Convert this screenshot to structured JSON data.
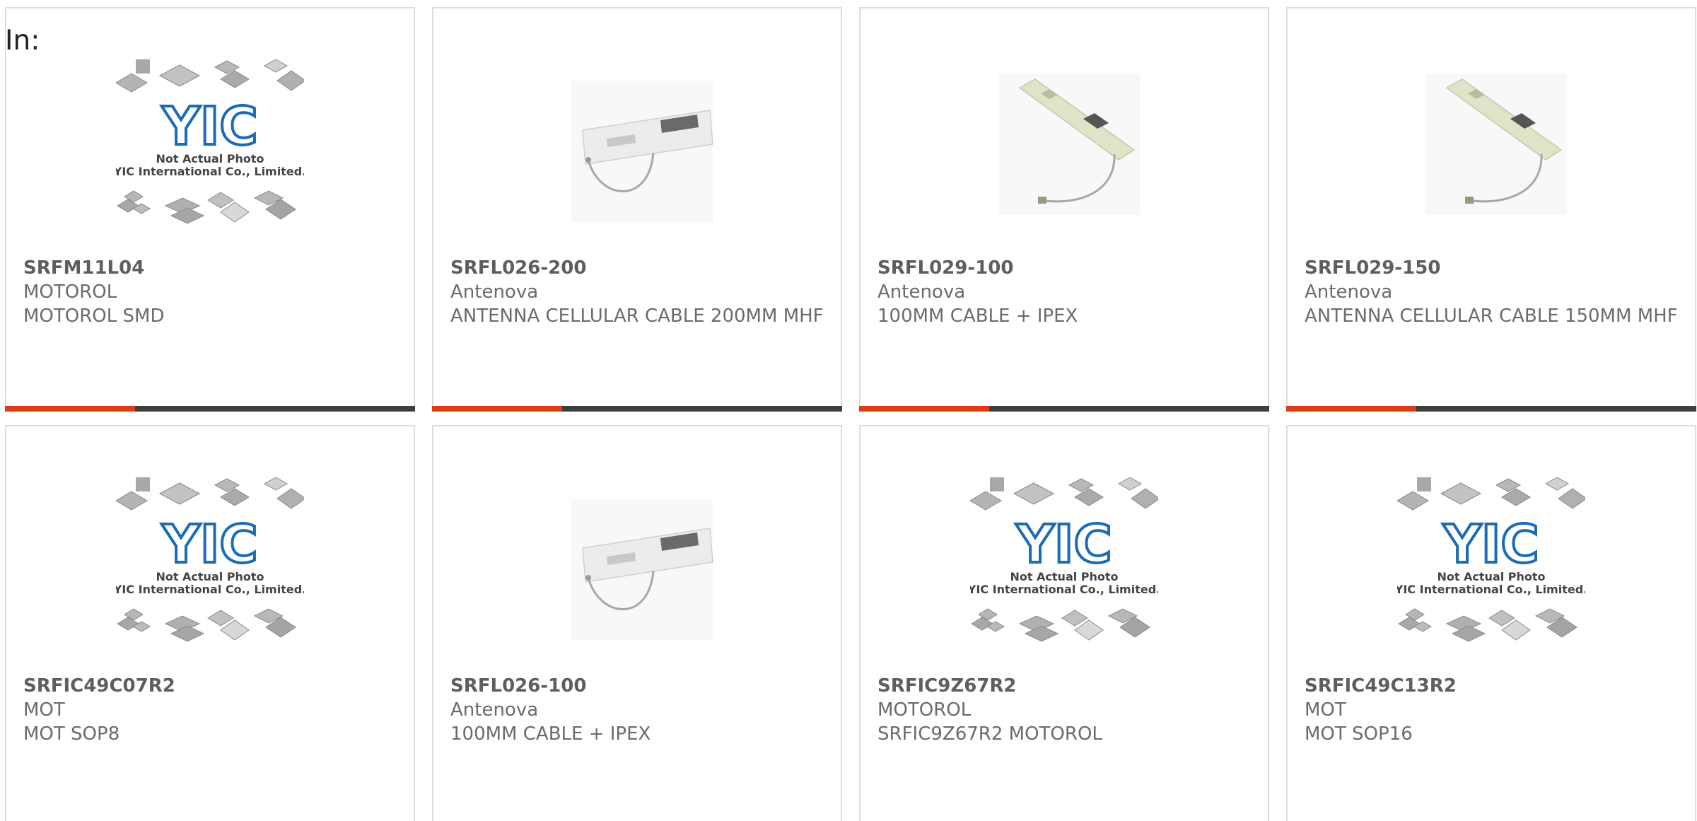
{
  "heading": "In:",
  "placeholder_text": {
    "line1": "Not Actual Photo",
    "line2": "YIC International Co., Limited."
  },
  "colors": {
    "accent": "#dd3a16",
    "bar": "#3e3e3e",
    "border": "#dddddd",
    "logo_blue": "#1c6bb5"
  },
  "products": [
    {
      "part": "SRFM11L04",
      "brand": "MOTOROL",
      "desc": "MOTOROL SMD",
      "image": "placeholder-logo"
    },
    {
      "part": "SRFL026-200",
      "brand": "Antenova",
      "desc": "ANTENNA CELLULAR CABLE 200MM MHF",
      "image": "antenna-white"
    },
    {
      "part": "SRFL029-100",
      "brand": "Antenova",
      "desc": "100MM CABLE + IPEX",
      "image": "antenna-pcb"
    },
    {
      "part": "SRFL029-150",
      "brand": "Antenova",
      "desc": "ANTENNA CELLULAR CABLE 150MM MHF",
      "image": "antenna-pcb"
    },
    {
      "part": "SRFIC49C07R2",
      "brand": "MOT",
      "desc": "MOT SOP8",
      "image": "placeholder-logo"
    },
    {
      "part": "SRFL026-100",
      "brand": "Antenova",
      "desc": "100MM CABLE + IPEX",
      "image": "antenna-white"
    },
    {
      "part": "SRFIC9Z67R2",
      "brand": "MOTOROL",
      "desc": "SRFIC9Z67R2 MOTOROL",
      "image": "placeholder-logo"
    },
    {
      "part": "SRFIC49C13R2",
      "brand": "MOT",
      "desc": "MOT SOP16",
      "image": "placeholder-logo"
    }
  ]
}
